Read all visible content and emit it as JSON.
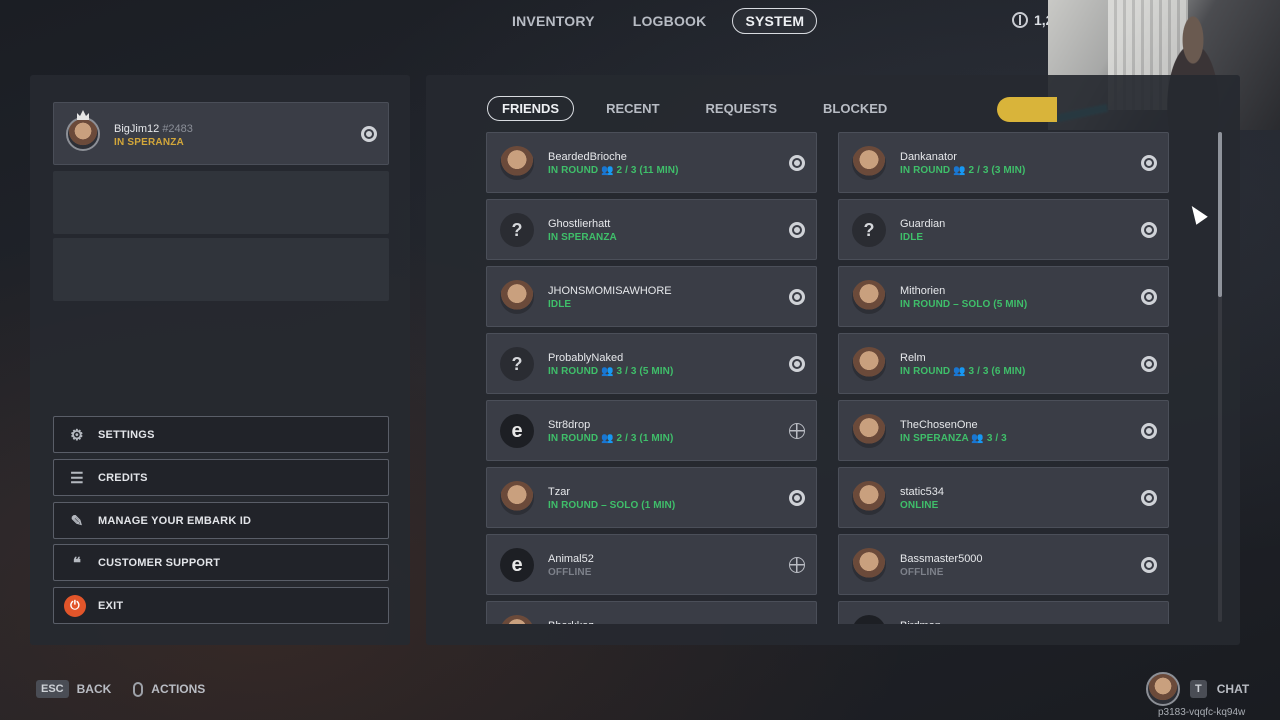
{
  "top_nav": {
    "tabs": [
      {
        "label": "INVENTORY",
        "active": false
      },
      {
        "label": "LOGBOOK",
        "active": false
      },
      {
        "label": "SYSTEM",
        "active": true
      }
    ],
    "currency_amount": "1,2"
  },
  "profile": {
    "name": "BigJim12",
    "tag": "#2483",
    "status": "IN SPERANZA",
    "platform_icon": "steam-icon"
  },
  "menu": [
    {
      "label": "SETTINGS",
      "icon": "gear-icon"
    },
    {
      "label": "CREDITS",
      "icon": "credits-icon"
    },
    {
      "label": "MANAGE YOUR EMBARK ID",
      "icon": "pencil-icon"
    },
    {
      "label": "CUSTOMER SUPPORT",
      "icon": "chat-bubbles-icon"
    },
    {
      "label": "EXIT",
      "icon": "power-icon"
    }
  ],
  "friend_tabs": [
    {
      "label": "FRIENDS",
      "active": true
    },
    {
      "label": "RECENT",
      "active": false
    },
    {
      "label": "REQUESTS",
      "active": false
    },
    {
      "label": "BLOCKED",
      "active": false
    }
  ],
  "friends": [
    {
      "name": "BeardedBrioche",
      "status": "IN ROUND  👥 2 / 3 (11 MIN)",
      "status_color": "green",
      "avatar": "photo",
      "platform": "steam-icon"
    },
    {
      "name": "Dankanator",
      "status": "IN ROUND  👥 2 / 3 (3 MIN)",
      "status_color": "green",
      "avatar": "photo",
      "platform": "steam-icon"
    },
    {
      "name": "Ghostlierhatt",
      "status": "IN SPERANZA",
      "status_color": "green",
      "avatar": "unknown",
      "platform": "steam-icon"
    },
    {
      "name": "Guardian",
      "status": "IDLE",
      "status_color": "green",
      "avatar": "unknown",
      "platform": "steam-icon"
    },
    {
      "name": "JHONSMOMISAWHORE",
      "status": "IDLE",
      "status_color": "green",
      "avatar": "photo",
      "platform": "steam-icon"
    },
    {
      "name": "Mithorien",
      "status": "IN ROUND – SOLO (5 MIN)",
      "status_color": "green",
      "avatar": "photo",
      "platform": "steam-icon"
    },
    {
      "name": "ProbablyNaked",
      "status": "IN ROUND  👥 3 / 3 (5 MIN)",
      "status_color": "green",
      "avatar": "unknown",
      "platform": "steam-icon"
    },
    {
      "name": "Relm",
      "status": "IN ROUND  👥 3 / 3 (6 MIN)",
      "status_color": "green",
      "avatar": "photo",
      "platform": "steam-icon"
    },
    {
      "name": "Str8drop",
      "status": "IN ROUND  👥 2 / 3 (1 MIN)",
      "status_color": "green",
      "avatar": "embark",
      "platform": "globe-icon"
    },
    {
      "name": "TheChosenOne",
      "status": "IN SPERANZA  👥 3 / 3",
      "status_color": "green",
      "avatar": "photo",
      "platform": "steam-icon"
    },
    {
      "name": "Tzar",
      "status": "IN ROUND – SOLO (1 MIN)",
      "status_color": "green",
      "avatar": "photo",
      "platform": "steam-icon"
    },
    {
      "name": "static534",
      "status": "ONLINE",
      "status_color": "green",
      "avatar": "photo",
      "platform": "steam-icon"
    },
    {
      "name": "Animal52",
      "status": "OFFLINE",
      "status_color": "gray",
      "avatar": "embark",
      "platform": "globe-icon"
    },
    {
      "name": "Bassmaster5000",
      "status": "OFFLINE",
      "status_color": "gray",
      "avatar": "photo",
      "platform": "steam-icon"
    },
    {
      "name": "Bharkkaz",
      "status": "",
      "status_color": "gray",
      "avatar": "photo",
      "platform": "steam-icon"
    },
    {
      "name": "Birdman",
      "status": "",
      "status_color": "gray",
      "avatar": "embark",
      "platform": "steam-icon"
    }
  ],
  "bottom_bar": {
    "back_key": "ESC",
    "back_label": "BACK",
    "actions_label": "ACTIONS",
    "chat_key": "T",
    "chat_label": "CHAT",
    "embark_id": "p3183-vqqfc-kq94w"
  },
  "colors": {
    "status_green": "#3fbf6a",
    "status_gold": "#d3a73a",
    "exit_red": "#e2552a",
    "accent_yellow": "#d9b43a"
  }
}
